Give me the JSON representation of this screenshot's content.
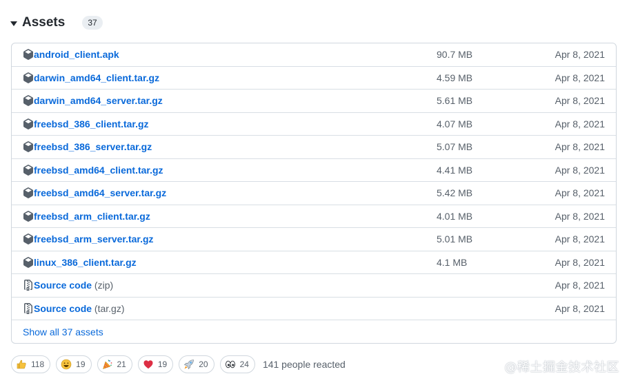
{
  "assets": {
    "title": "Assets",
    "count": "37",
    "rows": [
      {
        "name": "android_client.apk",
        "fmt": "",
        "size": "90.7 MB",
        "date": "Apr 8, 2021",
        "icon": "package-icon"
      },
      {
        "name": "darwin_amd64_client.tar.gz",
        "fmt": "",
        "size": "4.59 MB",
        "date": "Apr 8, 2021",
        "icon": "package-icon"
      },
      {
        "name": "darwin_amd64_server.tar.gz",
        "fmt": "",
        "size": "5.61 MB",
        "date": "Apr 8, 2021",
        "icon": "package-icon"
      },
      {
        "name": "freebsd_386_client.tar.gz",
        "fmt": "",
        "size": "4.07 MB",
        "date": "Apr 8, 2021",
        "icon": "package-icon"
      },
      {
        "name": "freebsd_386_server.tar.gz",
        "fmt": "",
        "size": "5.07 MB",
        "date": "Apr 8, 2021",
        "icon": "package-icon"
      },
      {
        "name": "freebsd_amd64_client.tar.gz",
        "fmt": "",
        "size": "4.41 MB",
        "date": "Apr 8, 2021",
        "icon": "package-icon"
      },
      {
        "name": "freebsd_amd64_server.tar.gz",
        "fmt": "",
        "size": "5.42 MB",
        "date": "Apr 8, 2021",
        "icon": "package-icon"
      },
      {
        "name": "freebsd_arm_client.tar.gz",
        "fmt": "",
        "size": "4.01 MB",
        "date": "Apr 8, 2021",
        "icon": "package-icon"
      },
      {
        "name": "freebsd_arm_server.tar.gz",
        "fmt": "",
        "size": "5.01 MB",
        "date": "Apr 8, 2021",
        "icon": "package-icon"
      },
      {
        "name": "linux_386_client.tar.gz",
        "fmt": "",
        "size": "4.1 MB",
        "date": "Apr 8, 2021",
        "icon": "package-icon"
      },
      {
        "name": "Source code",
        "fmt": " (zip)",
        "size": "",
        "date": "Apr 8, 2021",
        "icon": "file-zip-icon"
      },
      {
        "name": "Source code",
        "fmt": " (tar.gz)",
        "size": "",
        "date": "Apr 8, 2021",
        "icon": "file-zip-icon"
      }
    ],
    "show_all": "Show all 37 assets"
  },
  "reactions": {
    "items": [
      {
        "emoji": "thumbs-up-icon",
        "count": "118"
      },
      {
        "emoji": "smile-icon",
        "count": "19"
      },
      {
        "emoji": "tada-icon",
        "count": "21"
      },
      {
        "emoji": "heart-icon",
        "count": "19"
      },
      {
        "emoji": "rocket-icon",
        "count": "20"
      },
      {
        "emoji": "eyes-icon",
        "count": "24"
      }
    ],
    "summary": "141 people reacted"
  },
  "watermark": "@稀土掘金技术社区",
  "colors": {
    "link": "#0969da",
    "muted": "#57606a",
    "border": "#d0d7de"
  }
}
